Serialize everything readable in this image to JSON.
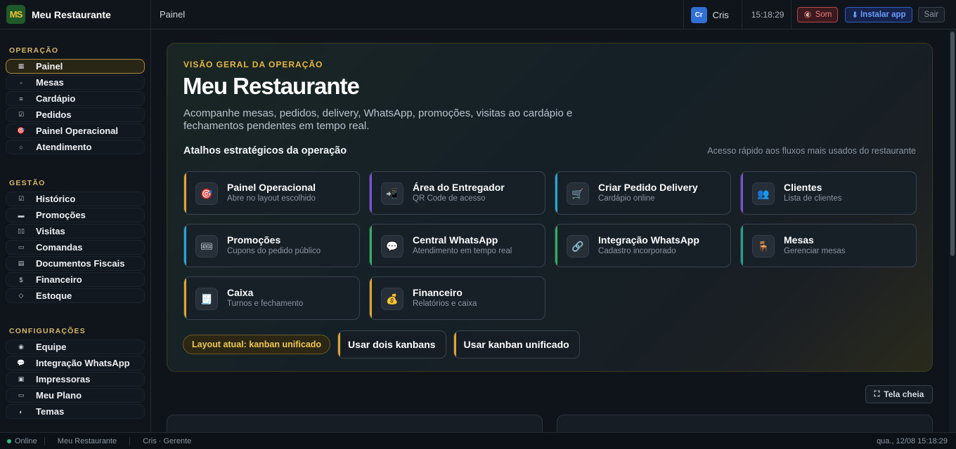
{
  "brand": {
    "logo": "MS",
    "name": "Meu Restaurante"
  },
  "topbar": {
    "breadcrumb": "Painel",
    "avatar": "Cr",
    "user": "Cris",
    "clock": "15:18:29",
    "sound_label": "Som",
    "install_label": "Instalar app",
    "logout_label": "Sair"
  },
  "sidebar": {
    "sections": [
      {
        "title": "OPERAÇÃO",
        "items": [
          {
            "label": "Painel",
            "icon": "grid-icon",
            "glyph": "▦",
            "active": true
          },
          {
            "label": "Mesas",
            "icon": "table-icon",
            "glyph": "▫"
          },
          {
            "label": "Cardápio",
            "icon": "menu-icon",
            "glyph": "≡"
          },
          {
            "label": "Pedidos",
            "icon": "check-icon",
            "glyph": "☑"
          },
          {
            "label": "Painel Operacional",
            "icon": "target-icon",
            "glyph": "🎯"
          },
          {
            "label": "Atendimento",
            "icon": "circle-icon",
            "glyph": "○"
          }
        ]
      },
      {
        "title": "GESTÃO",
        "items": [
          {
            "label": "Histórico",
            "icon": "check-icon",
            "glyph": "☑"
          },
          {
            "label": "Promoções",
            "icon": "ticket-icon",
            "glyph": "▬"
          },
          {
            "label": "Visitas",
            "icon": "chart-icon",
            "glyph": "▯▯"
          },
          {
            "label": "Comandas",
            "icon": "card-icon",
            "glyph": "▭"
          },
          {
            "label": "Documentos Fiscais",
            "icon": "document-icon",
            "glyph": "▤"
          },
          {
            "label": "Financeiro",
            "icon": "dollar-icon",
            "glyph": "$"
          },
          {
            "label": "Estoque",
            "icon": "diamond-icon",
            "glyph": "◇"
          }
        ]
      },
      {
        "title": "CONFIGURAÇÕES",
        "items": [
          {
            "label": "Equipe",
            "icon": "team-icon",
            "glyph": "◉"
          },
          {
            "label": "Integração WhatsApp",
            "icon": "chat-icon",
            "glyph": "💬"
          },
          {
            "label": "Impressoras",
            "icon": "printer-icon",
            "glyph": "▣"
          },
          {
            "label": "Meu Plano",
            "icon": "plan-icon",
            "glyph": "▭"
          },
          {
            "label": "Temas",
            "icon": "theme-icon",
            "glyph": "◐"
          }
        ]
      }
    ]
  },
  "hero": {
    "eyebrow": "VISÃO GERAL DA OPERAÇÃO",
    "title": "Meu Restaurante",
    "description": "Acompanhe mesas, pedidos, delivery, WhatsApp, promoções, visitas ao cardápio e fechamentos pendentes em tempo real.",
    "shortcuts_title": "Atalhos estratégicos da operação",
    "shortcuts_hint": "Acesso rápido aos fluxos mais usados do restaurante"
  },
  "shortcuts": [
    {
      "title": "Painel Operacional",
      "subtitle": "Abre no layout escolhido",
      "icon": "target-icon",
      "glyph": "🎯",
      "accent": "#e0a52c"
    },
    {
      "title": "Área do Entregador",
      "subtitle": "QR Code de acesso",
      "icon": "delivery-app-icon",
      "glyph": "📲",
      "accent": "#7b4fd8"
    },
    {
      "title": "Criar Pedido Delivery",
      "subtitle": "Cardápio online",
      "icon": "cart-icon",
      "glyph": "🛒",
      "accent": "#27a6d9"
    },
    {
      "title": "Clientes",
      "subtitle": "Lista de clientes",
      "icon": "users-icon",
      "glyph": "👥",
      "accent": "#7b4fd8"
    },
    {
      "title": "Promoções",
      "subtitle": "Cupons do pedido público",
      "icon": "ticket-icon",
      "glyph": "🎟",
      "accent": "#27a6d9"
    },
    {
      "title": "Central WhatsApp",
      "subtitle": "Atendimento em tempo real",
      "icon": "chat-icon",
      "glyph": "💬",
      "accent": "#2fb25a"
    },
    {
      "title": "Integração WhatsApp",
      "subtitle": "Cadastro incorporado",
      "icon": "link-icon",
      "glyph": "🔗",
      "accent": "#2fb25a"
    },
    {
      "title": "Mesas",
      "subtitle": "Gerenciar mesas",
      "icon": "chair-icon",
      "glyph": "🪑",
      "accent": "#1fa38a"
    },
    {
      "title": "Caixa",
      "subtitle": "Turnos e fechamento",
      "icon": "receipt-icon",
      "glyph": "🧾",
      "accent": "#e0a52c"
    },
    {
      "title": "Financeiro",
      "subtitle": "Relatórios e caixa",
      "icon": "money-bag-icon",
      "glyph": "💰",
      "accent": "#e0a52c"
    }
  ],
  "layout": {
    "current": "Layout atual: kanban unificado",
    "two_kanbans": "Usar dois kanbans",
    "unified_kanban": "Usar kanban unificado"
  },
  "fullscreen_label": "Tela cheia",
  "statusbar": {
    "status": "Online",
    "restaurant": "Meu Restaurante",
    "user": "Cris · Gerente",
    "datetime": "qua., 12/08 15:18:29"
  }
}
